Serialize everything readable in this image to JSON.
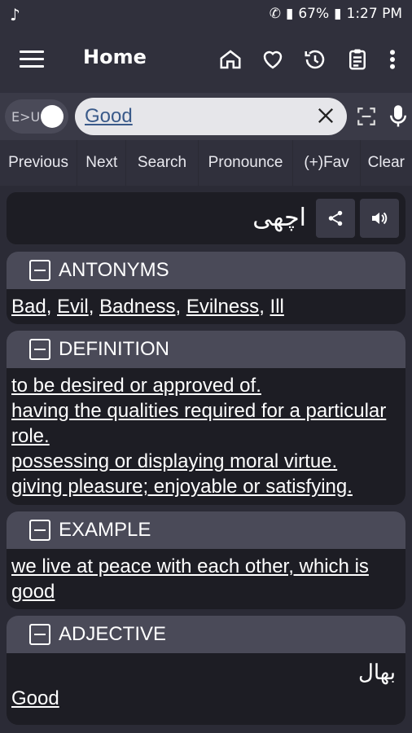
{
  "status": {
    "battery": "67%",
    "time": "1:27 PM"
  },
  "appbar": {
    "title": "Home"
  },
  "search": {
    "lang_toggle": "E>U",
    "value": "Good"
  },
  "toolbar": [
    "Previous",
    "Next",
    "Search",
    "Pronounce",
    "(+)Fav",
    "Clear"
  ],
  "translation": "اچھی",
  "sections": {
    "antonyms": {
      "title": "ANTONYMS",
      "words": [
        "Bad",
        "Evil",
        "Badness",
        "Evilness",
        "Ill"
      ]
    },
    "definition": {
      "title": "DEFINITION",
      "lines": [
        "to be desired or approved of.",
        "having the qualities required for a particular role.",
        "possessing or displaying moral virtue.",
        "giving pleasure; enjoyable or satisfying."
      ]
    },
    "example": {
      "title": "EXAMPLE",
      "text": "we live at peace with each other, which is good"
    },
    "adjective": {
      "title": "ADJECTIVE",
      "urdu": "بھال",
      "word": "Good"
    }
  },
  "colors": {
    "background": "#2b2b36",
    "header_bar": "#30303c",
    "section_head": "#4a4a58",
    "card": "#1d1d24"
  }
}
